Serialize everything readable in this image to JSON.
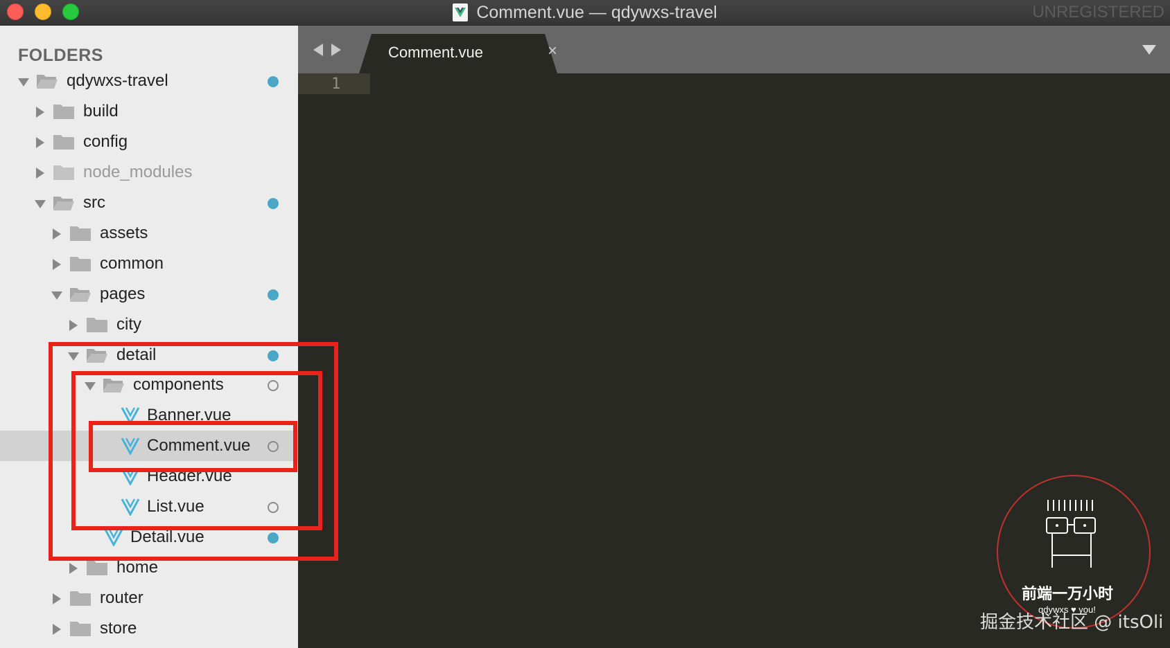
{
  "window": {
    "title": "Comment.vue — qdywxs-travel",
    "license_status": "UNREGISTERED"
  },
  "sidebar": {
    "header": "FOLDERS",
    "items": [
      {
        "label": "qdywxs-travel",
        "type": "folder",
        "expanded": true,
        "status": "modified"
      },
      {
        "label": "build",
        "type": "folder",
        "expanded": false,
        "status": ""
      },
      {
        "label": "config",
        "type": "folder",
        "expanded": false,
        "status": ""
      },
      {
        "label": "node_modules",
        "type": "folder",
        "expanded": false,
        "status": "ignored"
      },
      {
        "label": "src",
        "type": "folder",
        "expanded": true,
        "status": "modified"
      },
      {
        "label": "assets",
        "type": "folder",
        "expanded": false,
        "status": ""
      },
      {
        "label": "common",
        "type": "folder",
        "expanded": false,
        "status": ""
      },
      {
        "label": "pages",
        "type": "folder",
        "expanded": true,
        "status": "modified"
      },
      {
        "label": "city",
        "type": "folder",
        "expanded": false,
        "status": ""
      },
      {
        "label": "detail",
        "type": "folder",
        "expanded": true,
        "status": "modified"
      },
      {
        "label": "components",
        "type": "folder",
        "expanded": true,
        "status": "untracked"
      },
      {
        "label": "Banner.vue",
        "type": "vue-file",
        "status": ""
      },
      {
        "label": "Comment.vue",
        "type": "vue-file",
        "status": "untracked",
        "selected": true
      },
      {
        "label": "Header.vue",
        "type": "vue-file",
        "status": ""
      },
      {
        "label": "List.vue",
        "type": "vue-file",
        "status": "untracked"
      },
      {
        "label": "Detail.vue",
        "type": "vue-file",
        "status": "modified"
      },
      {
        "label": "home",
        "type": "folder",
        "expanded": false,
        "status": ""
      },
      {
        "label": "router",
        "type": "folder",
        "expanded": false,
        "status": ""
      },
      {
        "label": "store",
        "type": "folder",
        "expanded": false,
        "status": ""
      }
    ]
  },
  "editor": {
    "tabs": [
      {
        "label": "Comment.vue",
        "active": true
      }
    ],
    "close_glyph": "×",
    "line_numbers": [
      "1"
    ]
  },
  "watermark": {
    "title": "前端一万小时",
    "subtitle": "qdywxs ♥ you!",
    "brand": "掘金技术社区 @ itsOli"
  },
  "colors": {
    "titlebar": "#3b3b3b",
    "sidebar": "#ececec",
    "selected_row": "#d2d2d2",
    "editor_bg": "#282923",
    "tabbar": "#676767",
    "status_dot": "#4aa7c6",
    "annotation": "#e8231b",
    "vue_green": "#41b883",
    "vue_icon_blue": "#47b3d9"
  }
}
